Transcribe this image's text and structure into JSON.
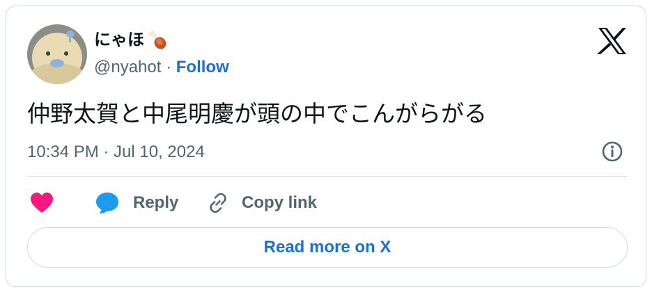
{
  "author": {
    "display_name": "にゃほ",
    "name_emoji_icon": "meat-on-bone-icon",
    "handle": "@nyahot",
    "separator": "·",
    "follow_label": "Follow"
  },
  "tweet": {
    "text": "仲野太賀と中尾明慶が頭の中でこんがらがる",
    "timestamp": "10:34 PM · Jul 10, 2024"
  },
  "actions": {
    "like_icon": "heart-icon",
    "reply_label": "Reply",
    "copy_link_label": "Copy link"
  },
  "footer": {
    "read_more_label": "Read more on X"
  },
  "colors": {
    "link_blue": "#1d6fd1",
    "like_pink": "#f91880",
    "reply_blue": "#1d9bf0",
    "secondary_text": "#536471",
    "border": "#cfd9de"
  }
}
